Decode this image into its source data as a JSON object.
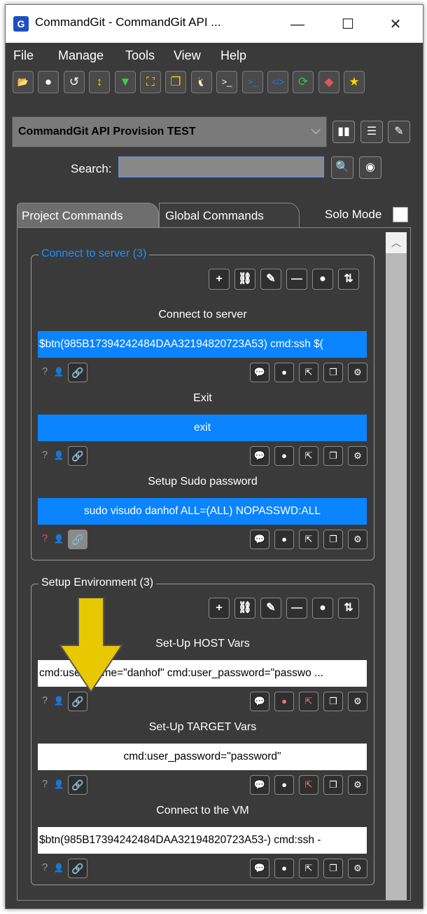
{
  "window": {
    "title": "CommandGit - CommandGit API ...",
    "app_icon": "commandgit-logo-icon",
    "minimize": "—",
    "maximize": "☐",
    "close": "✕"
  },
  "menu": [
    "File",
    "Manage",
    "Tools",
    "View",
    "Help"
  ],
  "toolbar": [
    {
      "name": "open-folder-icon",
      "glyph": "📂",
      "color": "#f5a623"
    },
    {
      "name": "clock-icon",
      "glyph": "●",
      "color": "#ffffff"
    },
    {
      "name": "history-icon",
      "glyph": "↺",
      "color": "#ffffff"
    },
    {
      "name": "sort-icon",
      "glyph": "↕",
      "color": "#f5d000"
    },
    {
      "name": "filter-icon",
      "glyph": "▼",
      "color": "#3bd14a"
    },
    {
      "name": "expand-icon",
      "glyph": "⛶",
      "color": "#f5d000"
    },
    {
      "name": "windows-icon",
      "glyph": "❐",
      "color": "#f5d000"
    },
    {
      "name": "linux-icon",
      "glyph": "🐧",
      "color": "#ffffff"
    },
    {
      "name": "terminal-icon",
      "glyph": ">_",
      "color": "#ffffff"
    },
    {
      "name": "powershell-icon",
      "glyph": ">_",
      "color": "#1e7ad9"
    },
    {
      "name": "code-icon",
      "glyph": "</>",
      "color": "#1e7ad9"
    },
    {
      "name": "refresh-icon",
      "glyph": "⟳",
      "color": "#2fc43e"
    },
    {
      "name": "eraser-icon",
      "glyph": "◆",
      "color": "#e05555"
    },
    {
      "name": "star-icon",
      "glyph": "★",
      "color": "#ffd200"
    }
  ],
  "project": {
    "selected": "CommandGit API Provision TEST",
    "chevron": "⌵"
  },
  "project_buttons": [
    {
      "name": "book-icon",
      "glyph": "▮▮"
    },
    {
      "name": "checklist-icon",
      "glyph": "☰"
    },
    {
      "name": "edit-icon",
      "glyph": "✎"
    }
  ],
  "search": {
    "label": "Search:",
    "value": "",
    "search_icon": "🔍",
    "stop_icon": "◉"
  },
  "tabs": {
    "project": "Project Commands",
    "global": "Global Commands",
    "solo_mode": "Solo Mode"
  },
  "group_buttons": [
    "+",
    "⛓",
    "✎",
    "—",
    "●",
    "⇅"
  ],
  "groups": [
    {
      "title": "Connect to server (3)",
      "title_color": "#1e90ff",
      "commands": [
        {
          "title": "Connect to server",
          "text": "$btn(985B17394242484DAA32194820723A53) cmd:ssh $(",
          "style": "blue",
          "align": "left",
          "help_color": "#9a9a9a",
          "link_color": "#ffffff",
          "msg_color": "#ffffff",
          "clock_color": "#ffffff",
          "share_color": "#ffffff"
        },
        {
          "title": "Exit",
          "text": "exit",
          "style": "blue",
          "align": "center",
          "help_color": "#9a9a9a",
          "link_color": "#ffffff",
          "msg_color": "#ffffff",
          "clock_color": "#ffffff",
          "share_color": "#ffffff"
        },
        {
          "title": "Setup Sudo password",
          "text": "sudo visudo danhof  ALL=(ALL) NOPASSWD:ALL",
          "style": "blue",
          "align": "center",
          "help_color": "#e05555",
          "link_color": "#ffffff",
          "msg_color": "#ffe100",
          "clock_color": "#ffffff",
          "share_color": "#ffffff",
          "link_bg": "#8a8a8a"
        }
      ]
    },
    {
      "title": "Setup Environment (3)",
      "title_color": "#ffffff",
      "commands": [
        {
          "title": "Set-Up HOST Vars",
          "text": "cmd:user_name=\"danhof\" cmd:user_password=\"passwo ...",
          "style": "white",
          "align": "left",
          "help_color": "#9a9a9a",
          "link_color": "#ff6666",
          "msg_color": "#ffe100",
          "clock_color": "#ff7070",
          "share_color": "#ff7070"
        },
        {
          "title": "Set-Up TARGET Vars",
          "text": "cmd:user_password=\"password\"",
          "style": "white",
          "align": "center",
          "help_color": "#9a9a9a",
          "link_color": "#ffffff",
          "msg_color": "#ffe100",
          "clock_color": "#ffffff",
          "share_color": "#ff7070"
        },
        {
          "title": "Connect to the VM",
          "text": "$btn(985B17394242484DAA32194820723A53-) cmd:ssh -",
          "style": "white",
          "align": "left",
          "help_color": "#9a9a9a",
          "link_color": "#ffffff",
          "msg_color": "#ffffff",
          "clock_color": "#ffffff",
          "share_color": "#ffffff"
        }
      ]
    }
  ],
  "command_icons": {
    "help": "?",
    "user": "👤",
    "link": "🔗",
    "message": "💬",
    "clock": "●",
    "share": "⇱",
    "copy": "❐",
    "settings": "⚙"
  },
  "annotation": {
    "arrow_color": "#e8c800"
  }
}
